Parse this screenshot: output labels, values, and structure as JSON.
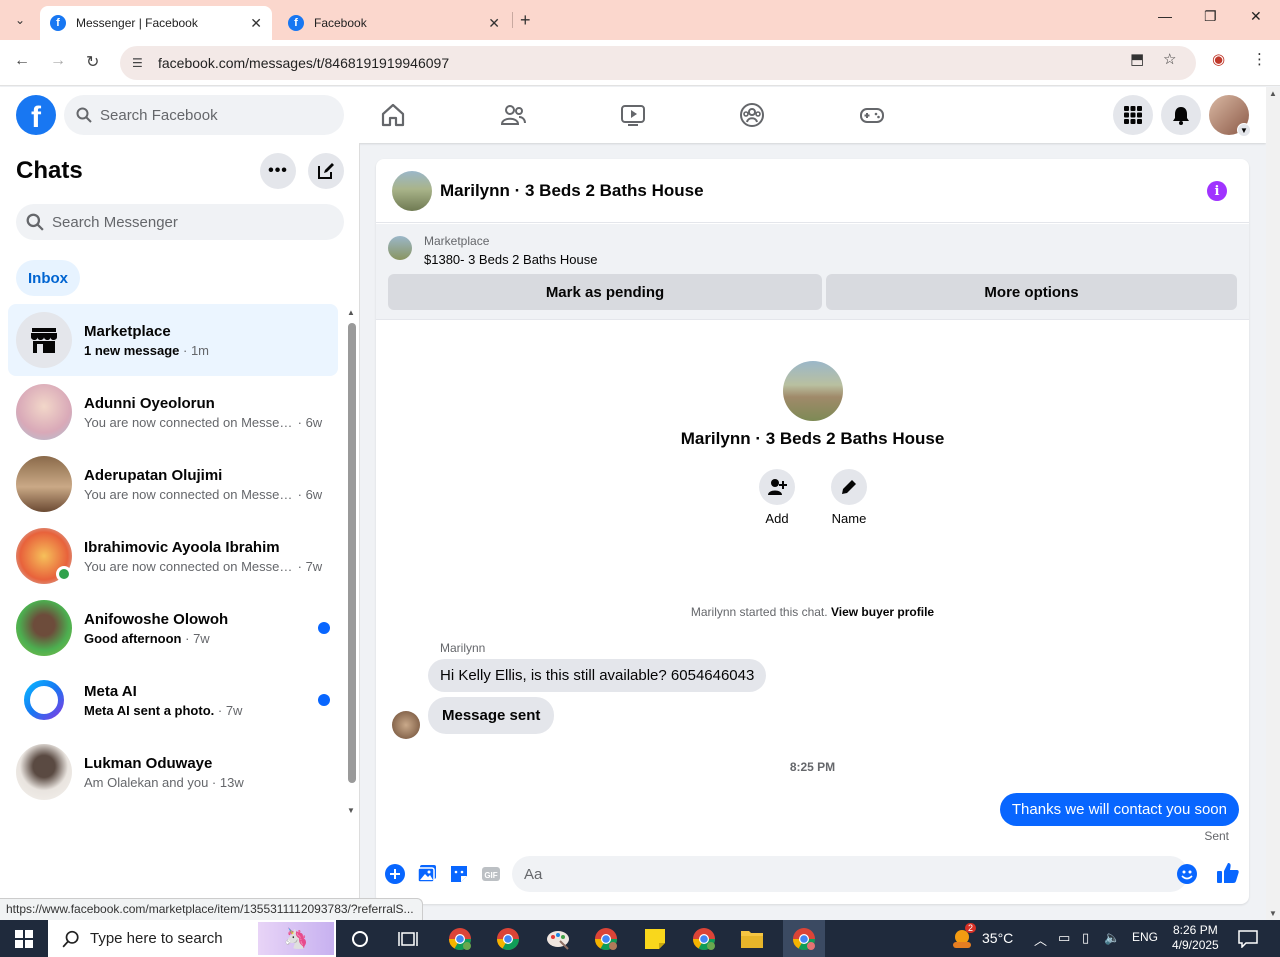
{
  "browser": {
    "tabs": [
      {
        "title": "Messenger | Facebook",
        "active": true
      },
      {
        "title": "Facebook",
        "active": false
      }
    ],
    "url": "facebook.com/messages/t/8468191919946097",
    "status_url": "https://www.facebook.com/marketplace/item/1355311112093783/?referralS..."
  },
  "fb": {
    "search_placeholder": "Search Facebook",
    "brand_color": "#1877f2"
  },
  "sidebar": {
    "title": "Chats",
    "search_placeholder": "Search Messenger",
    "filter_label": "Inbox",
    "chats": [
      {
        "name": "Marketplace",
        "snippet": "1 new message",
        "time": "1m",
        "unread": true,
        "selected": true,
        "dot": false
      },
      {
        "name": "Adunni Oyeolorun",
        "snippet": "You are now connected on Messenger",
        "time": "6w",
        "unread": false,
        "dot": false
      },
      {
        "name": "Aderupatan Olujimi",
        "snippet": "You are now connected on Messenger",
        "time": "6w",
        "unread": false,
        "dot": false
      },
      {
        "name": "Ibrahimovic Ayoola Ibrahim",
        "snippet": "You are now connected on Messenger",
        "time": "7w",
        "unread": false,
        "dot": false,
        "online": true
      },
      {
        "name": "Anifowoshe Olowoh",
        "snippet": "Good afternoon",
        "time": "7w",
        "unread": true,
        "dot": true
      },
      {
        "name": "Meta AI",
        "snippet": "Meta AI sent a photo.",
        "time": "7w",
        "unread": true,
        "dot": true
      },
      {
        "name": "Lukman Oduwaye",
        "snippet": "Am Olalekan and you",
        "time": "13w",
        "unread": false,
        "dot": false
      }
    ]
  },
  "conversation": {
    "title": "Marilynn · 3 Beds 2 Baths House",
    "marketplace": {
      "label": "Marketplace",
      "listing": "$1380- 3 Beds 2 Baths House",
      "mark_pending_label": "Mark as pending",
      "more_options_label": "More options"
    },
    "profile_name": "Marilynn · 3 Beds 2 Baths House",
    "actions": {
      "add_label": "Add",
      "name_label": "Name"
    },
    "system_note": {
      "text": "Marilynn started this chat.",
      "link": "View buyer profile"
    },
    "sender_name": "Marilynn",
    "messages_in": [
      "Hi Kelly Ellis, is this still available? 6054646043",
      "Message sent"
    ],
    "timestamp": "8:25 PM",
    "message_out": "Thanks we will contact you soon",
    "sent_label": "Sent",
    "composer_placeholder": "Aa",
    "accent_color": "#0866ff"
  },
  "taskbar": {
    "search_placeholder": "Type here to search",
    "weather": "35°C",
    "weather_badge": "2",
    "lang": "ENG",
    "time": "8:26 PM",
    "date": "4/9/2025"
  }
}
